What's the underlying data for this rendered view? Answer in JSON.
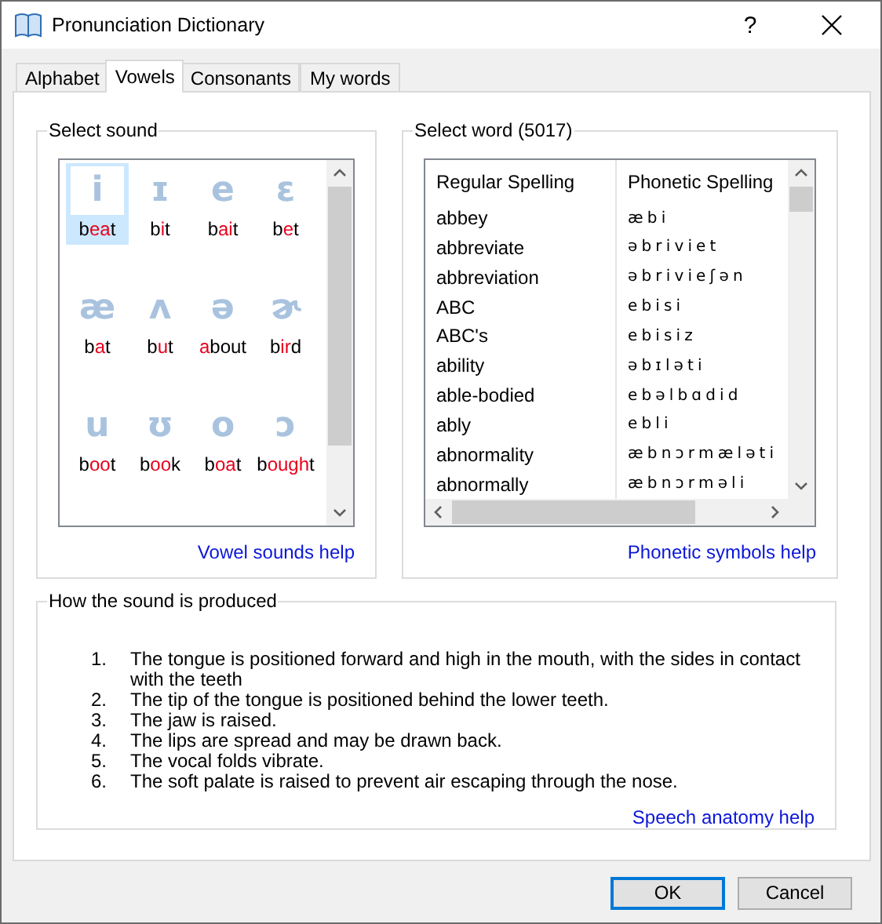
{
  "window": {
    "title": "Pronunciation Dictionary",
    "help_button": "?"
  },
  "tabs": [
    {
      "label": "Alphabet",
      "selected": false
    },
    {
      "label": "Vowels",
      "selected": true
    },
    {
      "label": "Consonants",
      "selected": false
    },
    {
      "label": "My words",
      "selected": false
    }
  ],
  "sound_group": {
    "title": "Select sound",
    "help_link": "Vowel sounds help",
    "sounds": [
      {
        "symbol": "i",
        "selected": true,
        "word": [
          {
            "text": "b",
            "red": false
          },
          {
            "text": "ea",
            "red": true
          },
          {
            "text": "t",
            "red": false
          }
        ]
      },
      {
        "symbol": "ɪ",
        "selected": false,
        "word": [
          {
            "text": "b",
            "red": false
          },
          {
            "text": "i",
            "red": true
          },
          {
            "text": "t",
            "red": false
          }
        ]
      },
      {
        "symbol": "e",
        "selected": false,
        "word": [
          {
            "text": "b",
            "red": false
          },
          {
            "text": "ai",
            "red": true
          },
          {
            "text": "t",
            "red": false
          }
        ]
      },
      {
        "symbol": "ɛ",
        "selected": false,
        "word": [
          {
            "text": "b",
            "red": false
          },
          {
            "text": "e",
            "red": true
          },
          {
            "text": "t",
            "red": false
          }
        ]
      },
      {
        "symbol": "æ",
        "selected": false,
        "word": [
          {
            "text": "b",
            "red": false
          },
          {
            "text": "a",
            "red": true
          },
          {
            "text": "t",
            "red": false
          }
        ]
      },
      {
        "symbol": "ʌ",
        "selected": false,
        "word": [
          {
            "text": "b",
            "red": false
          },
          {
            "text": "u",
            "red": true
          },
          {
            "text": "t",
            "red": false
          }
        ]
      },
      {
        "symbol": "ə",
        "selected": false,
        "word": [
          {
            "text": "a",
            "red": true
          },
          {
            "text": "bout",
            "red": false
          }
        ]
      },
      {
        "symbol": "ɚ",
        "selected": false,
        "word": [
          {
            "text": "b",
            "red": false
          },
          {
            "text": "ir",
            "red": true
          },
          {
            "text": "d",
            "red": false
          }
        ]
      },
      {
        "symbol": "u",
        "selected": false,
        "word": [
          {
            "text": "b",
            "red": false
          },
          {
            "text": "oo",
            "red": true
          },
          {
            "text": "t",
            "red": false
          }
        ]
      },
      {
        "symbol": "ʊ",
        "selected": false,
        "word": [
          {
            "text": "b",
            "red": false
          },
          {
            "text": "oo",
            "red": true
          },
          {
            "text": "k",
            "red": false
          }
        ]
      },
      {
        "symbol": "o",
        "selected": false,
        "word": [
          {
            "text": "b",
            "red": false
          },
          {
            "text": "oa",
            "red": true
          },
          {
            "text": "t",
            "red": false
          }
        ]
      },
      {
        "symbol": "ɔ",
        "selected": false,
        "word": [
          {
            "text": "b",
            "red": false
          },
          {
            "text": "ough",
            "red": true
          },
          {
            "text": "t",
            "red": false
          }
        ]
      }
    ]
  },
  "word_group": {
    "title": "Select word (5017)",
    "help_link": "Phonetic symbols help",
    "columns": [
      "Regular Spelling",
      "Phonetic Spelling"
    ],
    "rows": [
      [
        "abbey",
        "æ b i"
      ],
      [
        "abbreviate",
        "ə b r i v i e t"
      ],
      [
        "abbreviation",
        "ə b r i v i e ʃ ə n"
      ],
      [
        "ABC",
        "e b i s i"
      ],
      [
        "ABC's",
        "e b i s i z"
      ],
      [
        "ability",
        "ə b ɪ l ə t i"
      ],
      [
        "able-bodied",
        "e b ə l b ɑ d i d"
      ],
      [
        "ably",
        "e b l i"
      ],
      [
        "abnormality",
        "æ b n ɔ r m æ l ə t i"
      ],
      [
        "abnormally",
        "æ b n ɔ r m ə l i"
      ]
    ]
  },
  "production_group": {
    "title": "How the sound is produced",
    "help_link": "Speech anatomy help",
    "steps": [
      {
        "number": "1.",
        "text": "The tongue is positioned forward and high in the mouth, with the sides in contact with the teeth"
      },
      {
        "number": "2.",
        "text": "The tip of the tongue is positioned behind the lower teeth."
      },
      {
        "number": "3.",
        "text": "The jaw is raised."
      },
      {
        "number": "4.",
        "text": "The lips are spread and may be drawn back."
      },
      {
        "number": "5.",
        "text": "The vocal folds vibrate."
      },
      {
        "number": "6.",
        "text": "The soft palate is raised to prevent air escaping through the nose."
      }
    ]
  },
  "buttons": [
    {
      "label": "OK",
      "default": true
    },
    {
      "label": "Cancel",
      "default": false
    }
  ]
}
